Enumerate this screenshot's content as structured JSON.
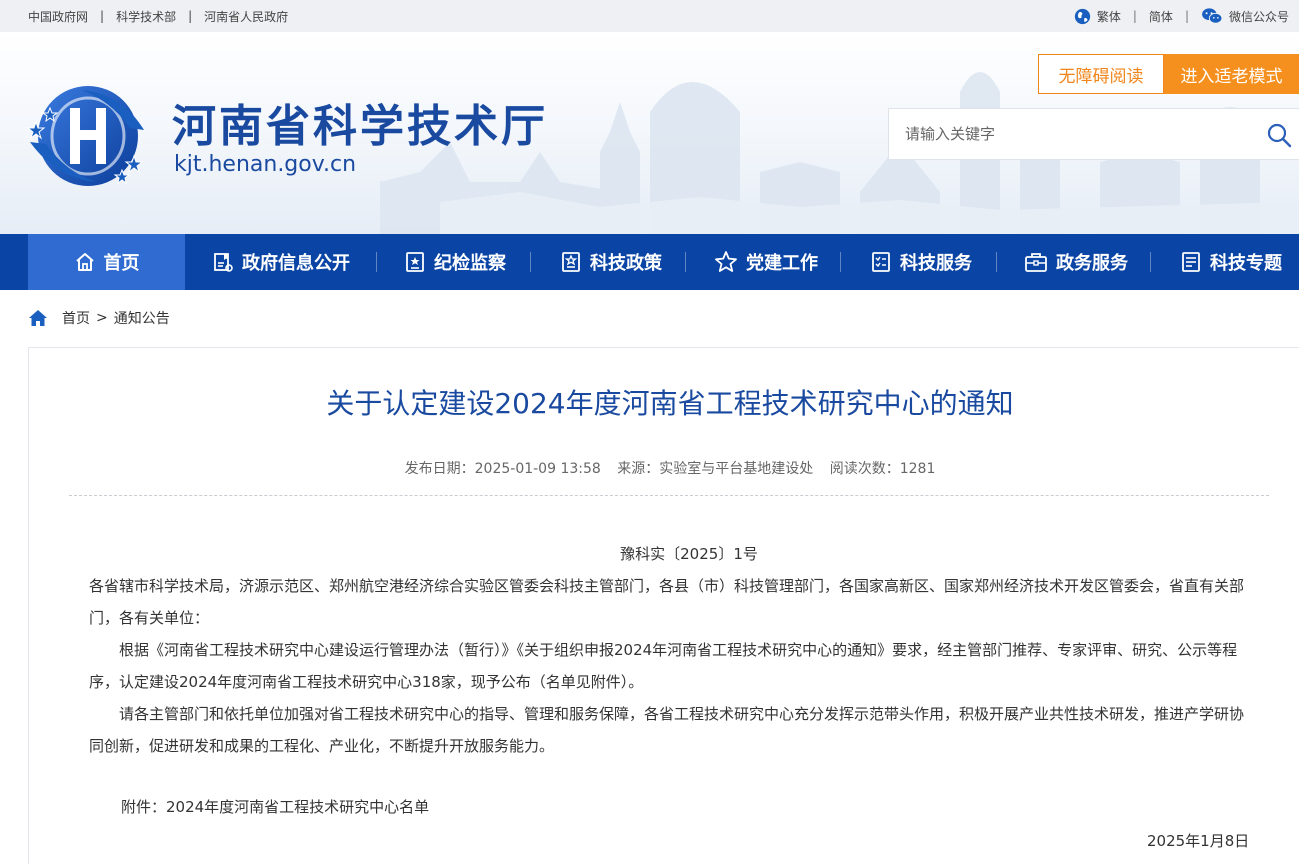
{
  "topbar": {
    "links": [
      "中国政府网",
      "科学技术部",
      "河南省人民政府"
    ],
    "separator": "|",
    "traditional": "繁体",
    "simplified": "简体",
    "wechat": "微信公众号"
  },
  "header": {
    "site_title": "河南省科学技术厅",
    "site_domain": "kjt.henan.gov.cn",
    "accessibility_btn": "无障碍阅读",
    "elder_mode_btn": "进入适老模式",
    "search_placeholder": "请输入关键字"
  },
  "nav": {
    "items": [
      {
        "label": "首页",
        "icon": "home-icon",
        "active": true
      },
      {
        "label": "政府信息公开",
        "icon": "info-disclosure-icon"
      },
      {
        "label": "纪检监察",
        "icon": "inspection-icon"
      },
      {
        "label": "科技政策",
        "icon": "policy-icon"
      },
      {
        "label": "党建工作",
        "icon": "star-icon"
      },
      {
        "label": "科技服务",
        "icon": "checklist-icon"
      },
      {
        "label": "政务服务",
        "icon": "briefcase-icon"
      },
      {
        "label": "科技专题",
        "icon": "document-icon"
      }
    ]
  },
  "breadcrumb": {
    "home": "首页",
    "separator": ">",
    "current": "通知公告"
  },
  "article": {
    "title": "关于认定建设2024年度河南省工程技术研究中心的通知",
    "publish_date": "发布日期：2025-01-09 13:58",
    "source": "来源：实验室与平台基地建设处",
    "views": "阅读次数：1281",
    "doc_number": "豫科实〔2025〕1号",
    "addressee": "各省辖市科学技术局，济源示范区、郑州航空港经济综合实验区管委会科技主管部门，各县（市）科技管理部门，各国家高新区、国家郑州经济技术开发区管委会，省直有关部门，各有关单位：",
    "paragraph1": "根据《河南省工程技术研究中心建设运行管理办法（暂行）》《关于组织申报2024年河南省工程技术研究中心的通知》要求，经主管部门推荐、专家评审、研究、公示等程序，认定建设2024年度河南省工程技术研究中心318家，现予公布（名单见附件）。",
    "paragraph2": "请各主管部门和依托单位加强对省工程技术研究中心的指导、管理和服务保障，各省工程技术研究中心充分发挥示范带头作用，积极开展产业共性技术研发，推进产学研协同创新，促进研发和成果的工程化、产业化，不断提升开放服务能力。",
    "attachment": "附件：2024年度河南省工程技术研究中心名单",
    "sign_date": "2025年1月8日"
  },
  "colors": {
    "primary_blue": "#0a44a4",
    "active_blue": "#2f6bd0",
    "title_blue": "#1a4aa0",
    "orange": "#f5901e"
  }
}
